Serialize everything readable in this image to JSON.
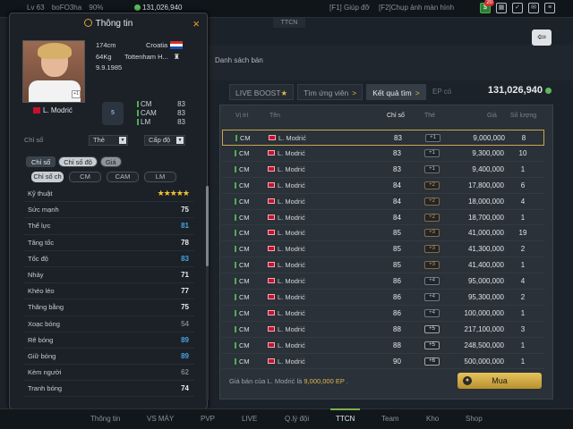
{
  "topbar": {
    "level": "Lv 63",
    "username": "boFO3ha",
    "progress": "90%",
    "ep": "131,026,940",
    "hotkey1": "[F1] Giúp đỡ",
    "hotkey2": "[F2]Chụp ảnh màn hình",
    "notification_count": "20",
    "icons": [
      "cash-icon",
      "calendar-icon",
      "check-icon",
      "mail-icon",
      "menu-icon"
    ]
  },
  "section_tab": "TTCN",
  "danh_sach_ban": "Danh sách bán",
  "market": {
    "tabs": [
      {
        "label": "LIVE BOOST",
        "suffix": "★"
      },
      {
        "label": "Tìm ứng viên",
        "suffix": ">"
      },
      {
        "label": "Kết quả tìm",
        "suffix": ">"
      }
    ],
    "ep_label": "EP có",
    "ep_value": "131,026,940",
    "headers": {
      "pos": "Vị trí",
      "name": "Tên",
      "ovr": "Chỉ số",
      "upgrade": "Thẻ",
      "price": "Giá",
      "qty": "Số lượng"
    },
    "rows": [
      {
        "pos": "CM",
        "name": "L. Modrić",
        "ovr": "83",
        "upg": "+1",
        "price": "9,000,000",
        "qty": "8"
      },
      {
        "pos": "CM",
        "name": "L. Modrić",
        "ovr": "83",
        "upg": "+1",
        "price": "9,300,000",
        "qty": "10"
      },
      {
        "pos": "CM",
        "name": "L. Modrić",
        "ovr": "83",
        "upg": "+1",
        "price": "9,400,000",
        "qty": "1"
      },
      {
        "pos": "CM",
        "name": "L. Modrić",
        "ovr": "84",
        "upg": "+2",
        "price": "17,800,000",
        "qty": "6"
      },
      {
        "pos": "CM",
        "name": "L. Modrić",
        "ovr": "84",
        "upg": "+2",
        "price": "18,000,000",
        "qty": "4"
      },
      {
        "pos": "CM",
        "name": "L. Modrić",
        "ovr": "84",
        "upg": "+2",
        "price": "18,700,000",
        "qty": "1"
      },
      {
        "pos": "CM",
        "name": "L. Modrić",
        "ovr": "85",
        "upg": "+3",
        "price": "41,000,000",
        "qty": "19"
      },
      {
        "pos": "CM",
        "name": "L. Modrić",
        "ovr": "85",
        "upg": "+3",
        "price": "41,300,000",
        "qty": "2"
      },
      {
        "pos": "CM",
        "name": "L. Modrić",
        "ovr": "85",
        "upg": "+3",
        "price": "41,400,000",
        "qty": "1"
      },
      {
        "pos": "CM",
        "name": "L. Modrić",
        "ovr": "86",
        "upg": "+4",
        "price": "95,000,000",
        "qty": "4"
      },
      {
        "pos": "CM",
        "name": "L. Modrić",
        "ovr": "86",
        "upg": "+4",
        "price": "95,300,000",
        "qty": "2"
      },
      {
        "pos": "CM",
        "name": "L. Modrić",
        "ovr": "86",
        "upg": "+4",
        "price": "100,000,000",
        "qty": "1"
      },
      {
        "pos": "CM",
        "name": "L. Modrić",
        "ovr": "88",
        "upg": "+5",
        "price": "217,100,000",
        "qty": "3"
      },
      {
        "pos": "CM",
        "name": "L. Modrić",
        "ovr": "88",
        "upg": "+5",
        "price": "248,500,000",
        "qty": "1"
      },
      {
        "pos": "CM",
        "name": "L. Modrić",
        "ovr": "90",
        "upg": "+6",
        "price": "500,000,000",
        "qty": "1"
      }
    ],
    "sell_note_prefix": "Giá bán của L. Modrić là ",
    "sell_note_value": "9,000,000 EP",
    "sell_note_suffix": " .",
    "buy_label": "Mua"
  },
  "info": {
    "title": "Thông tin",
    "close": "×",
    "height": "174cm",
    "weight": "64Kg",
    "birth": "9.9.1985",
    "nation": "Croatia",
    "club": "Tottenham H...",
    "player_name": "L. Modrić",
    "card_level": "+1",
    "card_badge": "5",
    "positions": [
      {
        "pos": "CM",
        "val": "83"
      },
      {
        "pos": "CAM",
        "val": "83"
      },
      {
        "pos": "LM",
        "val": "83"
      }
    ],
    "filter_label": "Chỉ số",
    "filter_card": "Thẻ",
    "filter_level": "Cấp độ",
    "tabs": [
      "Chỉ số",
      "Chỉ số độ",
      "Giá"
    ],
    "pos_tabs": [
      "Chỉ số ch",
      "CM",
      "CAM",
      "LM"
    ],
    "stats": [
      {
        "label": "Kỹ thuật",
        "value": "★★★★★",
        "kind": "stars"
      },
      {
        "label": "Sức mạnh",
        "value": "75",
        "kind": "white"
      },
      {
        "label": "Thể lực",
        "value": "81",
        "kind": "blue"
      },
      {
        "label": "Tăng tốc",
        "value": "78",
        "kind": "white"
      },
      {
        "label": "Tốc độ",
        "value": "83",
        "kind": "blue"
      },
      {
        "label": "Nhảy",
        "value": "71",
        "kind": "white"
      },
      {
        "label": "Khéo léo",
        "value": "77",
        "kind": "white"
      },
      {
        "label": "Thăng bằng",
        "value": "75",
        "kind": "white"
      },
      {
        "label": "Xoạc bóng",
        "value": "54",
        "kind": "gray"
      },
      {
        "label": "Rê bóng",
        "value": "89",
        "kind": "blue"
      },
      {
        "label": "Giữ bóng",
        "value": "89",
        "kind": "blue"
      },
      {
        "label": "Kèm người",
        "value": "62",
        "kind": "gray"
      },
      {
        "label": "Tranh bóng",
        "value": "74",
        "kind": "white"
      }
    ]
  },
  "nav": [
    "Thông tin",
    "VS MÁY",
    "PVP",
    "LIVE",
    "Q.lý đội",
    "TTCN",
    "Team",
    "Kho",
    "Shop"
  ],
  "colors": {
    "accent": "#c9a64a",
    "positive": "#4caf50",
    "stat_blue": "#4aa3df"
  }
}
